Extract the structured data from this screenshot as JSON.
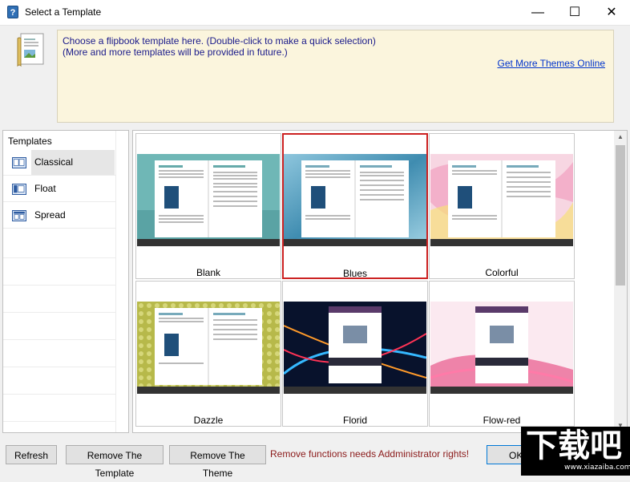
{
  "window": {
    "title": "Select a Template",
    "min_glyph": "—",
    "max_glyph": "☐",
    "close_glyph": "✕"
  },
  "banner": {
    "line1": "Choose a flipbook template here. (Double-click to make a quick selection)",
    "line2": "(More and more templates will be provided in future.)",
    "link": "Get More Themes Online"
  },
  "sidebar": {
    "header": "Templates",
    "items": [
      {
        "label": "Classical",
        "icon": "classical-icon",
        "selected": true
      },
      {
        "label": "Float",
        "icon": "float-icon",
        "selected": false
      },
      {
        "label": "Spread",
        "icon": "spread-icon",
        "selected": false
      }
    ]
  },
  "templates": [
    {
      "label": "Blank",
      "selected": false,
      "bg": "#6fb7b6"
    },
    {
      "label": "Blues",
      "selected": true,
      "bg": "#4f98b8"
    },
    {
      "label": "Colorful",
      "selected": false,
      "bg": "#f3b3c9"
    },
    {
      "label": "Dazzle",
      "selected": false,
      "bg": "#b7b94a"
    },
    {
      "label": "Florid",
      "selected": false,
      "bg": "#0c1a3a"
    },
    {
      "label": "Flow-red",
      "selected": false,
      "bg": "#f5dbe6"
    }
  ],
  "footer": {
    "refresh": "Refresh",
    "remove_template": "Remove The Template",
    "remove_theme": "Remove The Theme",
    "warning": "Remove functions needs Addministrator rights!",
    "ok": "OK"
  },
  "watermark": {
    "text": "下载吧",
    "url": "www.xiazaiba.com"
  }
}
